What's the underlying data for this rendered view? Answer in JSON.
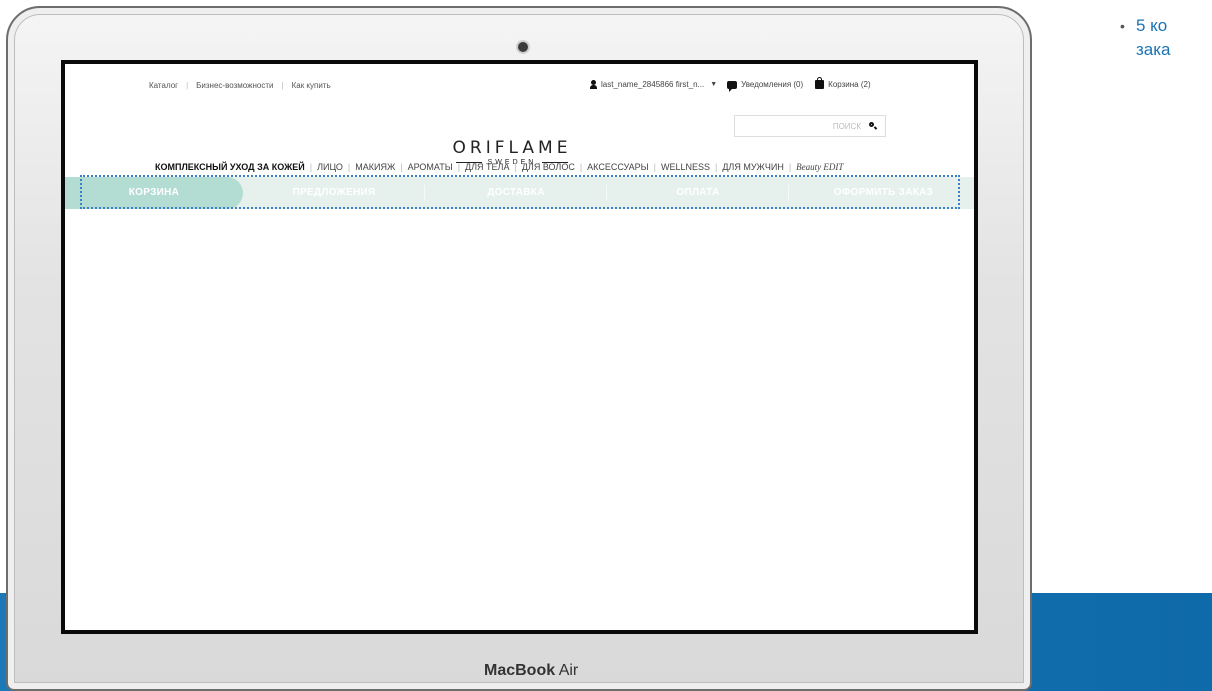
{
  "slide": {
    "bullet_line1": "5 ко",
    "bullet_line2": "зака",
    "bullet_glyph": "•"
  },
  "laptop": {
    "brand_bold": "MacBook",
    "brand_light": " Air"
  },
  "site": {
    "top_links": [
      "Каталог",
      "Бизнес-возможности",
      "Как купить"
    ],
    "user_name": "last_name_2845866 first_n...",
    "notifications": "Уведомления (0)",
    "cart": "Корзина (2)",
    "logo_main": "ORIFLAME",
    "logo_sub": "SWEDEN",
    "search_placeholder": "ПОИСК",
    "categories": [
      "КОМПЛЕКСНЫЙ УХОД ЗА КОЖЕЙ",
      "ЛИЦО",
      "МАКИЯЖ",
      "АРОМАТЫ",
      "ДЛЯ ТЕЛА",
      "ДЛЯ ВОЛОС",
      "АКСЕССУАРЫ",
      "WELLNESS",
      "ДЛЯ МУЖЧИН",
      "Beauty EDIT"
    ],
    "steps": [
      "КОРЗИНА",
      "ПРЕДЛОЖЕНИЯ",
      "ДОСТАВКА",
      "ОПЛАТА",
      "ОФОРМИТЬ ЗАКАЗ"
    ],
    "active_step": "КОРЗИНА"
  },
  "colors": {
    "slide_blue": "#1a73b5",
    "steps_bg": "#e6f1ee",
    "active_step_bg": "#b3dcd2",
    "highlight_dotted": "#3b7fc7"
  }
}
